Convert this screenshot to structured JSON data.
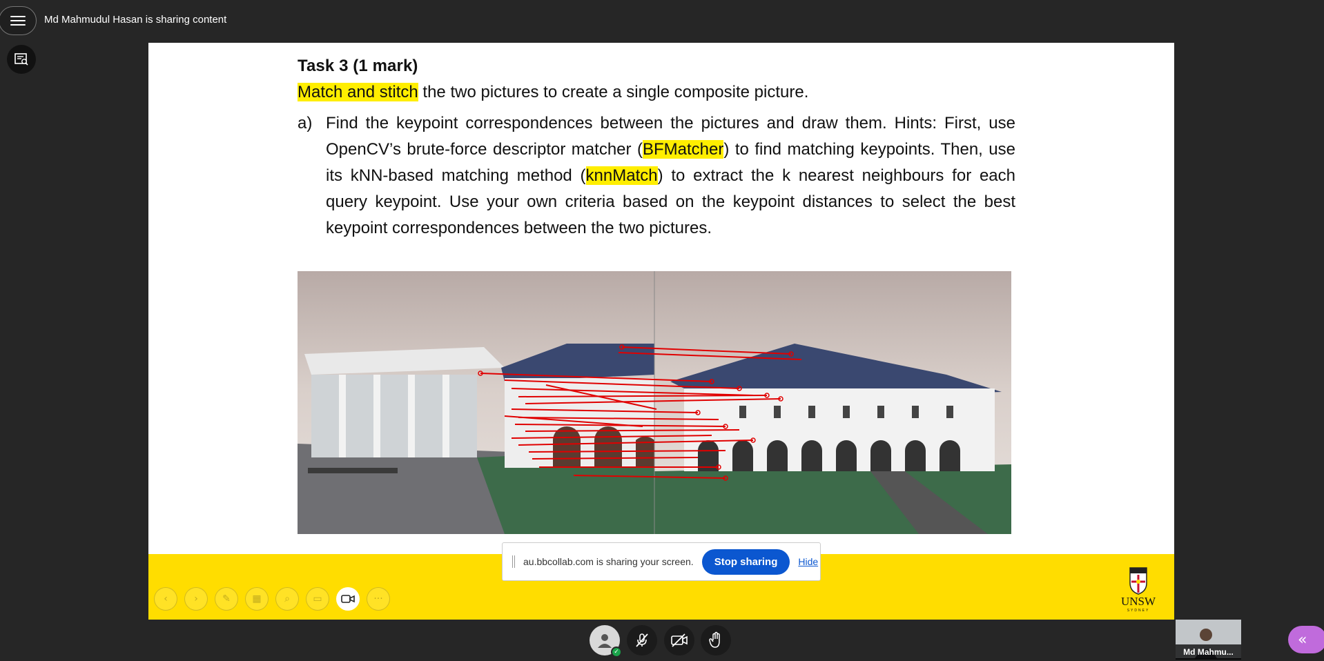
{
  "header": {
    "share_title": "Md Mahmudul Hasan is sharing content",
    "menu_icon": "hamburger-icon",
    "side_tool_icon": "captions-panel-icon"
  },
  "slide": {
    "task_title": "Task 3 (1 mark)",
    "intro_highlight": "Match and stitch",
    "intro_rest": " the two pictures to create a single composite picture.",
    "item_label": "a)",
    "item_part1": "Find the keypoint correspondences between the pictures and draw them. Hints: First, use OpenCV’s brute-force descriptor matcher (",
    "item_hl1": "BFMatcher",
    "item_part2": ") to find matching keypoints. Then, use its kNN-based matching method (",
    "item_hl2": "knnMatch",
    "item_part3": ") to extract the k nearest neighbours for each query keypoint. Use your own criteria based on the keypoint distances to select the best keypoint correspondences between the two pictures.",
    "logo_text": "UNSW",
    "logo_sub": "SYDNEY"
  },
  "slide_controls": [
    "prev-slide-icon",
    "next-slide-icon",
    "pen-icon",
    "layout-icon",
    "zoom-icon",
    "screen-icon",
    "camera-icon",
    "more-icon"
  ],
  "share_banner": {
    "message": "au.bbcollab.com is sharing your screen.",
    "stop_label": "Stop sharing",
    "hide_label": "Hide"
  },
  "bottom_controls": {
    "icons": [
      "my-status-icon",
      "microphone-off-icon",
      "camera-off-icon",
      "raise-hand-icon"
    ]
  },
  "video": {
    "name": "Md Mahmu..."
  },
  "colors": {
    "background": "#262626",
    "highlight": "#ffee00",
    "footer": "#ffdd00",
    "stop_button": "#0b57d0",
    "collab_button": "#c06bdc"
  }
}
